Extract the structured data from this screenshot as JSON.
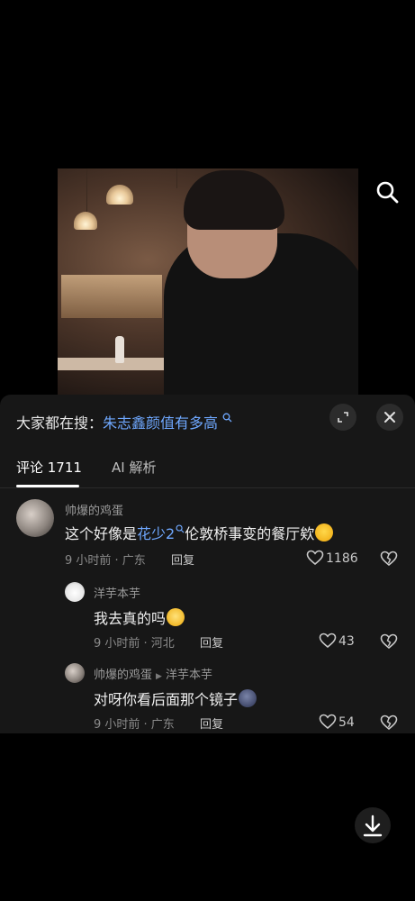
{
  "hot_search": {
    "prefix": "大家都在搜：",
    "term": "朱志鑫颜值有多高"
  },
  "tabs": [
    {
      "label": "评论 1711",
      "active": true
    },
    {
      "label": "AI 解析",
      "active": false
    }
  ],
  "comments": [
    {
      "author": "帅爆的鸡蛋",
      "text_before": "这个好像是",
      "text_link": "花少2",
      "text_after": "伦敦桥事变的餐厅欸",
      "emoji": "scared-face-emoji",
      "time_location": "9 小时前 · 广东",
      "reply_label": "回复",
      "likes": "1186"
    },
    {
      "author": "洋芋本芋",
      "text": "我去真的吗",
      "emoji": "astonished-face-emoji",
      "time_location": "9 小时前 · 河北",
      "reply_label": "回复",
      "likes": "43"
    },
    {
      "author": "帅爆的鸡蛋",
      "reply_to": "洋芋本芋",
      "text": "对呀你看后面那个镜子",
      "emoji": "blob-emoji",
      "time_location": "9 小时前 · 广东",
      "reply_label": "回复",
      "likes": "54"
    }
  ],
  "colors": {
    "accent_link": "#6fa8ff",
    "sheet_bg": "#171717",
    "page_bg": "#000000"
  }
}
